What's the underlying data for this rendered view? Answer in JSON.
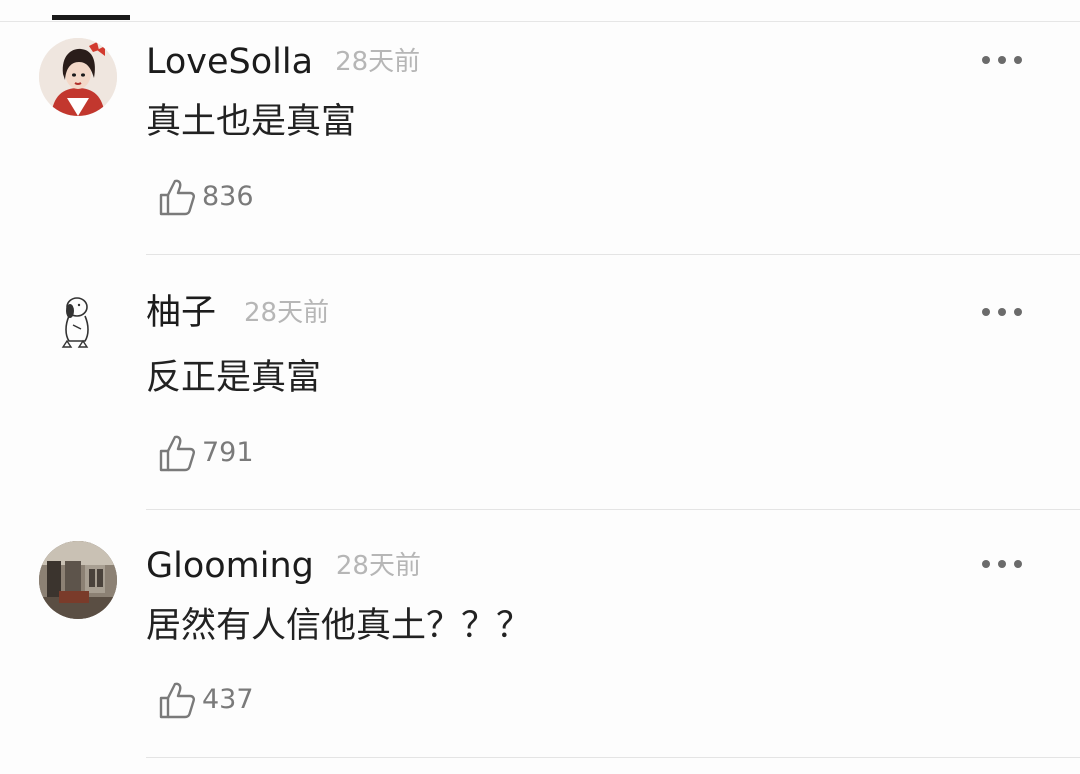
{
  "comments": [
    {
      "username": "LoveSolla",
      "time": "28天前",
      "content": "真土也是真富",
      "likes": "836",
      "avatar": "avatar-woman-red-bow"
    },
    {
      "username": "柚子",
      "time": "28天前",
      "content": "反正是真富",
      "likes": "791",
      "avatar": "avatar-snoopy-sketch"
    },
    {
      "username": "Glooming",
      "time": "28天前",
      "content": "居然有人信他真土？？？",
      "likes": "437",
      "avatar": "avatar-room-photo"
    }
  ],
  "icons": {
    "like": "thumbs-up-icon",
    "more": "more-dots-icon"
  },
  "colors": {
    "text": "#1c1c1c",
    "timestamp": "#b6b6b6",
    "meta": "#7a7a7a",
    "divider": "#e4e4e4"
  }
}
